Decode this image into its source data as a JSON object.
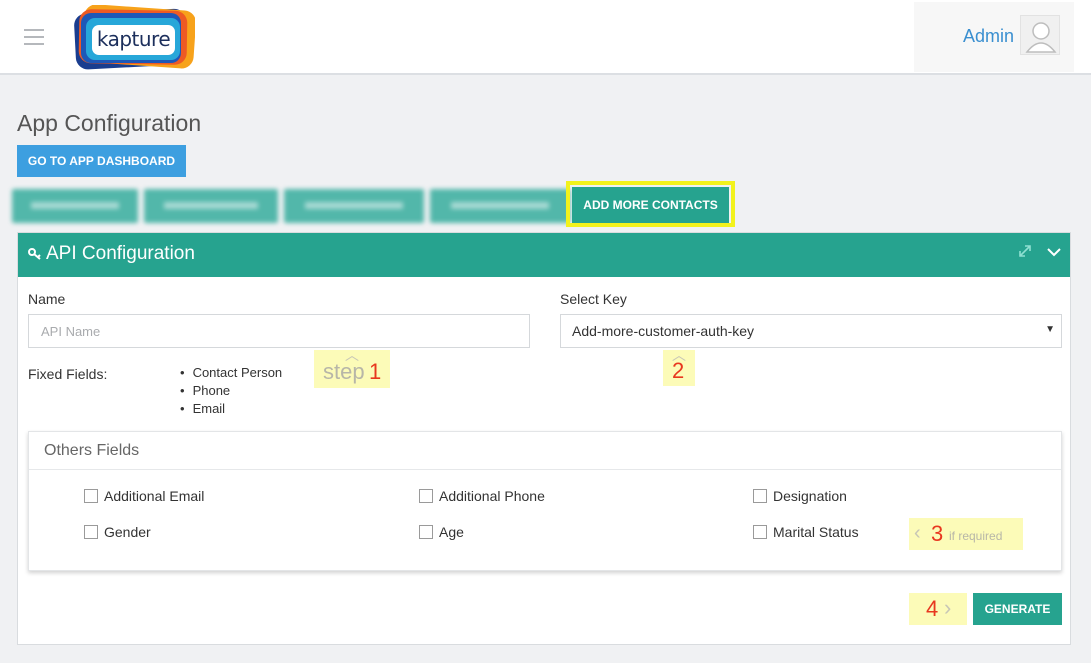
{
  "header": {
    "logo_text": "kapture",
    "user_name": "Admin",
    "accent": "#3a8fd0"
  },
  "page": {
    "title": "App Configuration",
    "dashboard_button": "GO TO APP DASHBOARD",
    "add_more_contacts_button": "ADD MORE CONTACTS",
    "primary_color": "#26a38f",
    "highlight_color": "#f2f21c"
  },
  "panel": {
    "title": "API Configuration",
    "name_label": "Name",
    "name_placeholder": "API Name",
    "select_key_label": "Select Key",
    "select_key_value": "Add-more-customer-auth-key",
    "fixed_fields_label": "Fixed Fields:",
    "fixed_fields": [
      "Contact Person",
      "Phone",
      "Email"
    ],
    "others_title": "Others Fields",
    "others": [
      {
        "label": "Additional Email"
      },
      {
        "label": "Additional Phone"
      },
      {
        "label": "Designation"
      },
      {
        "label": "Gender"
      },
      {
        "label": "Age"
      },
      {
        "label": "Marital Status"
      }
    ],
    "generate_button": "GENERATE"
  },
  "annotations": {
    "step1_word": "step",
    "step1_num": "1",
    "step2_num": "2",
    "step3_num": "3",
    "step3_note": "if required",
    "step4_num": "4"
  }
}
